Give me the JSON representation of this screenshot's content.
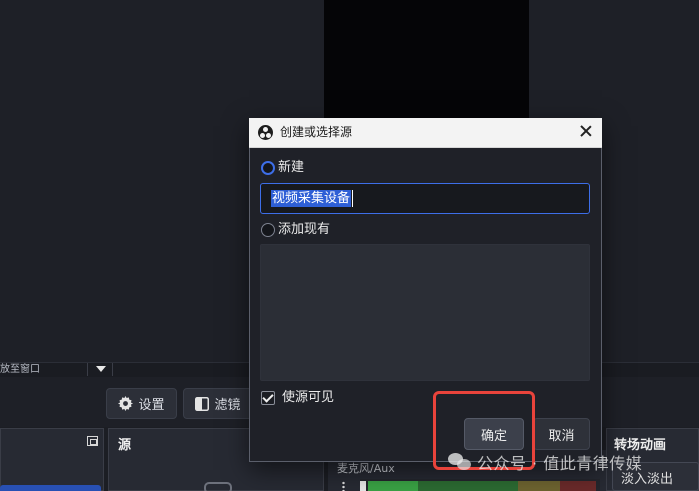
{
  "background": {
    "zoom_label": "放至窗口",
    "toolbar": {
      "settings_label": "设置",
      "filters_label": "滤镜"
    },
    "sources_dock": {
      "title": "源"
    },
    "mixer": {
      "channel_label": "麦克风/Aux"
    },
    "transitions_dock": {
      "title": "转场动画",
      "selected": "淡入淡出"
    }
  },
  "dialog": {
    "title": "创建或选择源",
    "new_option_label": "新建",
    "new_option_selected": true,
    "name_value": "视频采集设备",
    "existing_option_label": "添加现有",
    "existing_option_selected": false,
    "existing_items": [],
    "visible_checkbox_label": "使源可见",
    "visible_checked": true,
    "ok_label": "确定",
    "cancel_label": "取消"
  },
  "watermark": {
    "text": "公众号 · 值此青律传媒"
  },
  "colors": {
    "accent": "#3d6ee8",
    "highlight": "#e8433b",
    "meter_green": "#3aa345",
    "meter_yellow": "#b8a73a",
    "meter_red": "#b23a3a"
  },
  "icons": {
    "settings": "gear-icon",
    "filters": "filter-icon",
    "close": "close-icon",
    "app": "obs-logo-icon"
  }
}
